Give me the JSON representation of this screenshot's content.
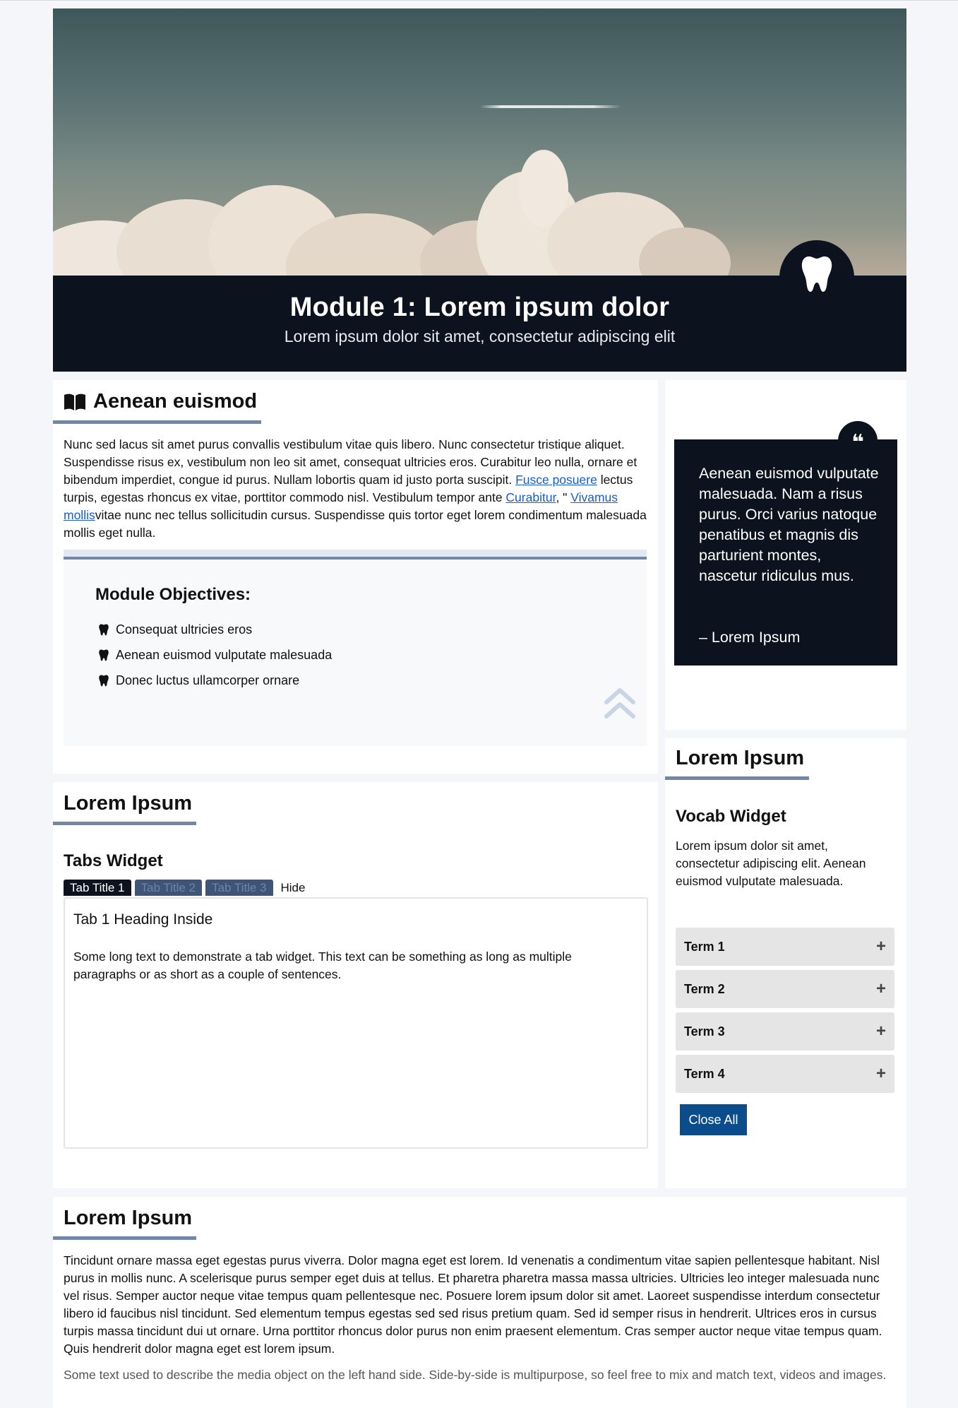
{
  "module": {
    "title": "Module 1: Lorem ipsum dolor",
    "subtitle": "Lorem ipsum dolor sit amet, consectetur adipiscing elit",
    "badge_icon": "tooth-icon"
  },
  "intro": {
    "heading": "Aenean euismod",
    "heading_icon": "book-open-icon",
    "text_1": "Nunc sed lacus sit amet purus convallis vestibulum vitae quis libero. Nunc consectetur tristique aliquet. Suspendisse risus ex, vestibulum non leo sit amet, consequat ultricies eros. Curabitur leo nulla, ornare et bibendum imperdiet, congue id purus. Nullam lobortis quam id justo porta suscipit. ",
    "link_1": "Fusce posuere",
    "text_2": " lectus turpis, egestas rhoncus ex vitae, porttitor commodo nisl. Vestibulum tempor ante ",
    "link_2": "Curabitur",
    "text_3": ", \" ",
    "link_3": "Vivamus mollis",
    "text_4": "vitae nunc nec tellus sollicitudin cursus. Suspendisse quis tortor eget lorem condimentum malesuada mollis eget nulla."
  },
  "objectives": {
    "title": "Module Objectives:",
    "bullet_icon": "tooth-icon",
    "items": [
      "Consequat ultricies eros",
      "Aenean euismod vulputate malesuada",
      "Donec luctus ullamcorper ornare"
    ],
    "scroll_icon": "double-chevron-up-icon"
  },
  "quote": {
    "icon": "quote-icon",
    "mark": "❝",
    "text": "Aenean euismod vulputate malesuada. Nam a risus purus. Orci varius natoque penatibus et magnis dis parturient montes, nascetur ridiculus mus.",
    "attribution": "– Lorem Ipsum"
  },
  "tabs_section": {
    "heading": "Lorem Ipsum",
    "widget_title": "Tabs Widget",
    "tabs": [
      "Tab Title 1",
      "Tab Title 2",
      "Tab Title 3"
    ],
    "active_tab": 0,
    "hide_label": "Hide",
    "panel_heading": "Tab 1 Heading Inside",
    "panel_text": "Some long text to demonstrate a tab widget. This text can be something as long as multiple paragraphs or as short as a couple of sentences."
  },
  "vocab_section": {
    "heading": "Lorem Ipsum",
    "widget_title": "Vocab Widget",
    "description": "Lorem ipsum dolor sit amet, consectetur adipiscing elit. Aenean euismod vulputate malesuada.",
    "terms": [
      "Term 1",
      "Term 2",
      "Term 3",
      "Term 4"
    ],
    "expand_symbol": "+",
    "close_all": "Close All"
  },
  "bottom_section": {
    "heading": "Lorem Ipsum",
    "paragraph": "Tincidunt ornare massa eget egestas purus viverra. Dolor magna eget est lorem. Id venenatis a condimentum vitae sapien pellentesque habitant. Nisl purus in mollis nunc. A scelerisque purus semper eget duis at tellus. Et pharetra pharetra massa massa ultricies. Ultricies leo integer malesuada nunc vel risus. Semper auctor neque vitae tempus quam pellentesque nec. Posuere lorem ipsum dolor sit amet. Laoreet suspendisse interdum consectetur libero id faucibus nisl tincidunt. Sed elementum tempus egestas sed sed risus pretium quam. Sed id semper risus in hendrerit. Ultrices eros in cursus turpis massa tincidunt dui ut ornare. Urna porttitor rhoncus dolor purus non enim praesent elementum. Cras semper auctor neque vitae tempus quam. Quis hendrerit dolor magna eget est lorem ipsum.",
    "media_caption": "Some text used to describe the media object on the left hand side. Side-by-side is multipurpose, so feel free to mix and match text, videos and images."
  },
  "colors": {
    "dark_navy": "#0c121e",
    "accent_underline": "#7286a6",
    "link": "#1a5cc8",
    "button_blue": "#0a4c8c"
  }
}
